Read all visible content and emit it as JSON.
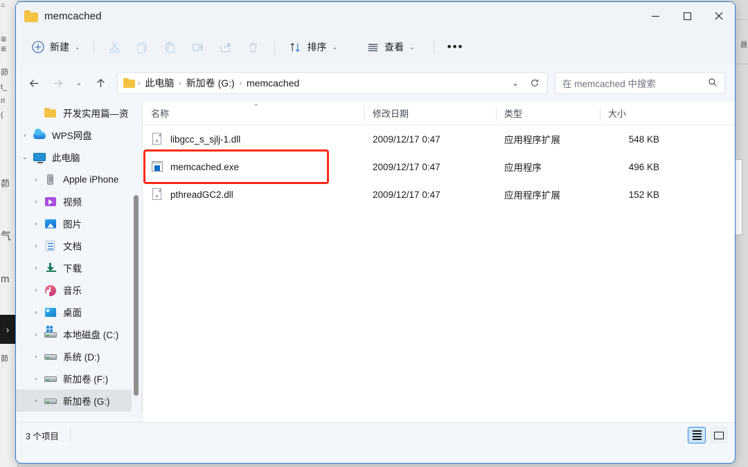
{
  "window": {
    "title": "memcached",
    "folder_icon": "folder-icon",
    "minimize": "—",
    "maximize": "□",
    "close": "✕"
  },
  "toolbar": {
    "new_label": "新建",
    "new_icon": "plus-circle-icon",
    "cut_icon": "scissors-icon",
    "copy_icon": "copy-icon",
    "paste_icon": "paste-icon",
    "rename_icon": "rename-icon",
    "share_icon": "share-icon",
    "delete_icon": "trash-icon",
    "sort_label": "排序",
    "sort_icon": "sort-arrows-icon",
    "view_label": "查看",
    "view_icon": "view-lines-icon",
    "more_icon": "ellipsis-icon",
    "chevron": "⌄"
  },
  "navigation": {
    "back_icon": "arrow-left-icon",
    "forward_icon": "arrow-right-icon",
    "recent_icon": "chevron-down-icon",
    "up_icon": "arrow-up-icon",
    "refresh_icon": "refresh-icon",
    "address_dropdown_icon": "chevron-down-icon"
  },
  "breadcrumb": {
    "folder_icon": "folder-icon",
    "separator": "›",
    "items": [
      {
        "label": "此电脑"
      },
      {
        "label": "新加卷 (G:)"
      },
      {
        "label": "memcached"
      }
    ]
  },
  "search": {
    "placeholder": "在 memcached 中搜索",
    "icon": "search-icon"
  },
  "sidebar": {
    "scroll_thumb": true,
    "items": [
      {
        "label": "开发实用篇—资",
        "icon": "folder-icon",
        "indent": 1,
        "arrow": "",
        "selected": false
      },
      {
        "label": "WPS网盘",
        "icon": "cloud-icon",
        "indent": 0,
        "arrow": "›",
        "selected": false
      },
      {
        "label": "此电脑",
        "icon": "monitor-icon",
        "indent": 0,
        "arrow": "⌄",
        "selected": false
      },
      {
        "label": "Apple iPhone",
        "icon": "phone-icon",
        "indent": 1,
        "arrow": "›",
        "selected": false
      },
      {
        "label": "视频",
        "icon": "video-icon",
        "indent": 1,
        "arrow": "›",
        "selected": false
      },
      {
        "label": "图片",
        "icon": "picture-icon",
        "indent": 1,
        "arrow": "›",
        "selected": false
      },
      {
        "label": "文档",
        "icon": "document-icon",
        "indent": 1,
        "arrow": "›",
        "selected": false
      },
      {
        "label": "下载",
        "icon": "download-icon",
        "indent": 1,
        "arrow": "›",
        "selected": false
      },
      {
        "label": "音乐",
        "icon": "music-icon",
        "indent": 1,
        "arrow": "›",
        "selected": false
      },
      {
        "label": "桌面",
        "icon": "desktop-icon",
        "indent": 1,
        "arrow": "›",
        "selected": false
      },
      {
        "label": "本地磁盘 (C:)",
        "icon": "drive-system-icon",
        "indent": 1,
        "arrow": "›",
        "selected": false
      },
      {
        "label": "系统 (D:)",
        "icon": "drive-icon",
        "indent": 1,
        "arrow": "›",
        "selected": false
      },
      {
        "label": "新加卷 (F:)",
        "icon": "drive-icon",
        "indent": 1,
        "arrow": "›",
        "selected": false
      },
      {
        "label": "新加卷 (G:)",
        "icon": "drive-icon",
        "indent": 1,
        "arrow": "›",
        "selected": true
      }
    ]
  },
  "filelist": {
    "columns": [
      {
        "label": "名称",
        "sorted": true,
        "sort_caret": "⌃"
      },
      {
        "label": "修改日期",
        "sorted": false,
        "sort_caret": ""
      },
      {
        "label": "类型",
        "sorted": false,
        "sort_caret": ""
      },
      {
        "label": "大小",
        "sorted": false,
        "sort_caret": ""
      }
    ],
    "rows": [
      {
        "name": "libgcc_s_sjlj-1.dll",
        "icon": "dll-file-icon",
        "date": "2009/12/17 0:47",
        "type": "应用程序扩展",
        "size": "548 KB",
        "highlighted": false
      },
      {
        "name": "memcached.exe",
        "icon": "exe-file-icon",
        "date": "2009/12/17 0:47",
        "type": "应用程序",
        "size": "496 KB",
        "highlighted": true
      },
      {
        "name": "pthreadGC2.dll",
        "icon": "dll-file-icon",
        "date": "2009/12/17 0:47",
        "type": "应用程序扩展",
        "size": "152 KB",
        "highlighted": false
      }
    ]
  },
  "annotation": {
    "color": "#fb2a17",
    "target": "memcached.exe"
  },
  "statusbar": {
    "item_count": "3 个项目",
    "details_view_icon": "details-view-icon",
    "large_icons_view_icon": "large-icons-view-icon"
  },
  "background": {
    "left_glyphs": [
      "○",
      "≡",
      "茆",
      "t_",
      "ri",
      "(",
      "气",
      "m",
      "›",
      "茆"
    ],
    "right_glyphs": [
      "器"
    ]
  }
}
